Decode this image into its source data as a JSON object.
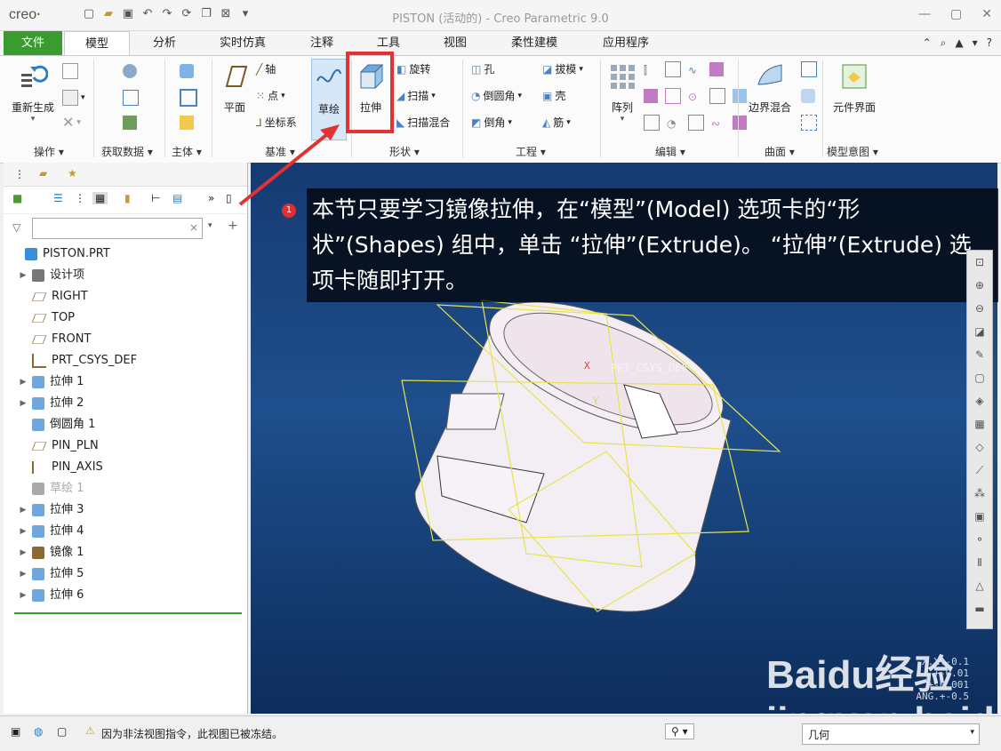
{
  "app": {
    "title": "PISTON (活动的) - Creo Parametric 9.0",
    "logo": "creo"
  },
  "tabs": [
    {
      "label": "文件"
    },
    {
      "label": "模型"
    },
    {
      "label": "分析"
    },
    {
      "label": "实时仿真"
    },
    {
      "label": "注释"
    },
    {
      "label": "工具"
    },
    {
      "label": "视图"
    },
    {
      "label": "柔性建模"
    },
    {
      "label": "应用程序"
    }
  ],
  "ribbon": {
    "regen": "重新生成",
    "operation_group": "操作",
    "get_data_group": "获取数据",
    "body_group": "主体",
    "plane": "平面",
    "axis": "轴",
    "point": "点",
    "csys": "坐标系",
    "datum_group": "基准",
    "sketch": "草绘",
    "extrude": "拉伸",
    "revolve": "旋转",
    "sweep": "扫描",
    "swept_blend": "扫描混合",
    "shapes_group": "形状",
    "hole": "孔",
    "round": "倒圆角",
    "chamfer": "倒角",
    "draft": "拔模",
    "shell": "壳",
    "rib": "筋",
    "engineering_group": "工程",
    "pattern": "阵列",
    "editing_group": "编辑",
    "boundary_blend": "边界混合",
    "surfaces_group": "曲面",
    "component_interface": "元件界面",
    "model_intent_group": "模型意图"
  },
  "tree": {
    "items": [
      {
        "label": "PISTON.PRT",
        "icon": "part-icon",
        "expandable": false,
        "indent": 0
      },
      {
        "label": "设计项",
        "icon": "design-items-icon",
        "expandable": true,
        "indent": 1
      },
      {
        "label": "RIGHT",
        "icon": "datum-plane-icon",
        "expandable": false,
        "indent": 1
      },
      {
        "label": "TOP",
        "icon": "datum-plane-icon",
        "expandable": false,
        "indent": 1
      },
      {
        "label": "FRONT",
        "icon": "datum-plane-icon",
        "expandable": false,
        "indent": 1
      },
      {
        "label": "PRT_CSYS_DEF",
        "icon": "csys-icon",
        "expandable": false,
        "indent": 1
      },
      {
        "label": "拉伸 1",
        "icon": "extrude-icon",
        "expandable": true,
        "indent": 1
      },
      {
        "label": "拉伸 2",
        "icon": "extrude-icon",
        "expandable": true,
        "indent": 1
      },
      {
        "label": "倒圆角 1",
        "icon": "round-icon",
        "expandable": false,
        "indent": 1
      },
      {
        "label": "PIN_PLN",
        "icon": "datum-plane-icon",
        "expandable": false,
        "indent": 1
      },
      {
        "label": "PIN_AXIS",
        "icon": "axis-icon",
        "expandable": false,
        "indent": 1
      },
      {
        "label": "草绘 1",
        "icon": "sketch-icon",
        "expandable": false,
        "indent": 1,
        "dim": true
      },
      {
        "label": "拉伸 3",
        "icon": "extrude-icon",
        "expandable": true,
        "indent": 1
      },
      {
        "label": "拉伸 4",
        "icon": "extrude-icon",
        "expandable": true,
        "indent": 1
      },
      {
        "label": "镜像 1",
        "icon": "mirror-icon",
        "expandable": true,
        "indent": 1
      },
      {
        "label": "拉伸 5",
        "icon": "extrude-icon",
        "expandable": true,
        "indent": 1
      },
      {
        "label": "拉伸 6",
        "icon": "extrude-icon",
        "expandable": true,
        "indent": 1
      }
    ]
  },
  "viewport": {
    "csys_label": "PRT_CSYS_DEF",
    "axis_x": "X",
    "axis_y": "Y",
    "coords": [
      "X.X+-0.1",
      "+-0.01",
      "+-0.001",
      "ANG.+-0.5"
    ]
  },
  "callout": {
    "number": "1",
    "text": "本节只要学习镜像拉伸，在“模型”(Model) 选项卡的“形状”(Shapes) 组中，单击 “拉伸”(Extrude)。 “拉伸”(Extrude) 选项卡随即打开。"
  },
  "status": {
    "message": "因为非法视图指令，此视图已被冻结。",
    "filter": "几何"
  },
  "watermark": "Baidu经验 jingyan.baidu.com",
  "colors": {
    "accent_green": "#3a9b2e",
    "highlight_red": "#e23232"
  }
}
